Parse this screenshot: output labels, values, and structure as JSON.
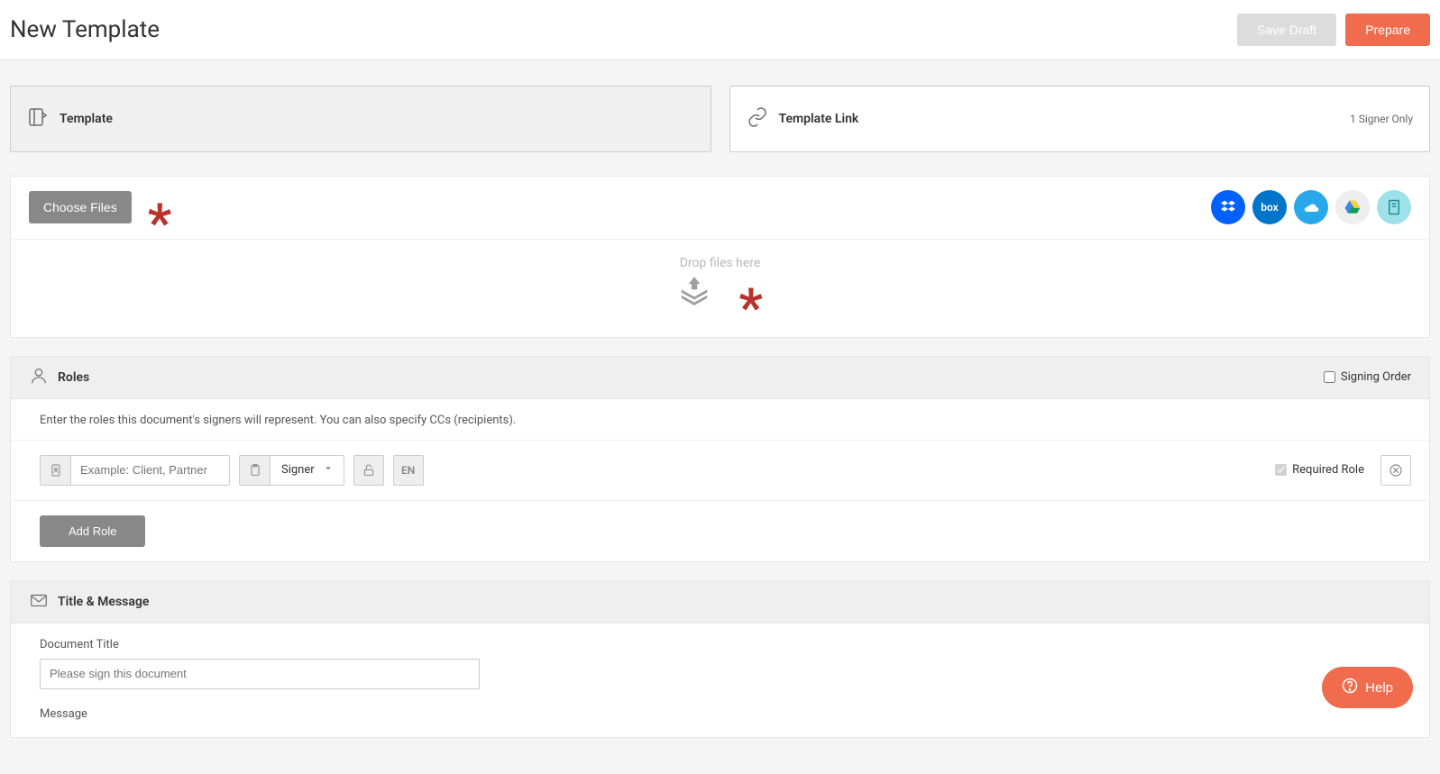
{
  "header": {
    "title": "New Template",
    "saveDraft": "Save Draft",
    "prepare": "Prepare"
  },
  "tabs": {
    "template": "Template",
    "templateLink": "Template Link",
    "signerOnly": "1 Signer Only"
  },
  "files": {
    "chooseFiles": "Choose Files",
    "dropHere": "Drop files here"
  },
  "roles": {
    "title": "Roles",
    "signingOrder": "Signing Order",
    "description": "Enter the roles this document's signers will represent. You can also specify CCs (recipients).",
    "rolePlaceholder": "Example: Client, Partner",
    "signerType": "Signer",
    "langCode": "EN",
    "requiredRole": "Required Role",
    "addRole": "Add Role"
  },
  "titleMessage": {
    "title": "Title & Message",
    "docTitleLabel": "Document Title",
    "docTitlePlaceholder": "Please sign this document",
    "messageLabel": "Message"
  },
  "help": "Help"
}
